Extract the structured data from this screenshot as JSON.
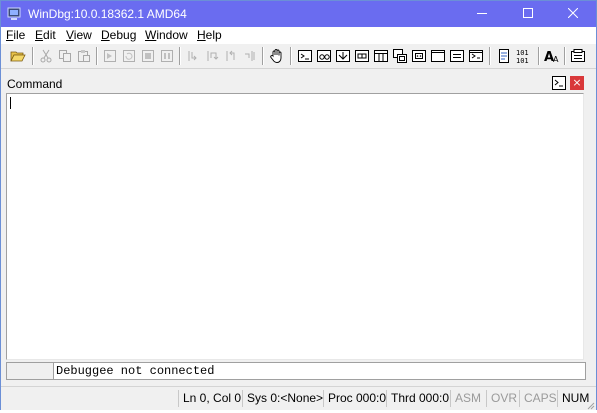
{
  "window": {
    "title": "WinDbg:10.0.18362.1 AMD64",
    "title_bar_color": "#6a6cf0",
    "controls": [
      "minimize-icon",
      "maximize-icon",
      "close-icon"
    ]
  },
  "menu": {
    "items": [
      {
        "label": "File"
      },
      {
        "label": "Edit"
      },
      {
        "label": "View"
      },
      {
        "label": "Debug"
      },
      {
        "label": "Window"
      },
      {
        "label": "Help"
      }
    ]
  },
  "toolbar": {
    "buttons": [
      {
        "icon": "open-folder-icon",
        "enabled": true
      },
      {
        "icon": "cut-icon",
        "enabled": false
      },
      {
        "icon": "copy-icon",
        "enabled": false
      },
      {
        "icon": "paste-icon",
        "enabled": false
      },
      {
        "icon": "go-icon",
        "enabled": false
      },
      {
        "icon": "restart-icon",
        "enabled": false
      },
      {
        "icon": "stop-debugging-icon",
        "enabled": false
      },
      {
        "icon": "break-icon",
        "enabled": false
      },
      {
        "icon": "step-into-icon",
        "enabled": false
      },
      {
        "icon": "step-over-icon",
        "enabled": false
      },
      {
        "icon": "step-out-icon",
        "enabled": false
      },
      {
        "icon": "run-to-cursor-icon",
        "enabled": false
      },
      {
        "icon": "source-mode-hand-icon",
        "enabled": true
      },
      {
        "icon": "command-window-icon",
        "enabled": true
      },
      {
        "icon": "watch-window-icon",
        "enabled": true
      },
      {
        "icon": "locals-window-icon",
        "enabled": true
      },
      {
        "icon": "registers-window-icon",
        "enabled": true
      },
      {
        "icon": "memory-window-icon",
        "enabled": true
      },
      {
        "icon": "call-stack-window-icon",
        "enabled": true
      },
      {
        "icon": "disassembly-window-icon",
        "enabled": true
      },
      {
        "icon": "scratch-pad-window-icon",
        "enabled": true
      },
      {
        "icon": "processes-threads-window-icon",
        "enabled": true
      },
      {
        "icon": "command-browser-window-icon",
        "enabled": true
      },
      {
        "icon": "source-mode-icon",
        "enabled": true
      },
      {
        "icon": "hex-mode-icon",
        "enabled": true
      },
      {
        "icon": "font-icon",
        "enabled": true
      },
      {
        "icon": "options-icon",
        "enabled": true
      }
    ]
  },
  "command_window": {
    "title": "Command",
    "output_text": "",
    "input_text": "Debuggee not connected"
  },
  "statusbar": {
    "ln_col": "Ln 0, Col 0",
    "sys": "Sys 0:<None>",
    "proc": "Proc 000:0",
    "thrd": "Thrd 000:0",
    "asm": "ASM",
    "ovr": "OVR",
    "caps": "CAPS",
    "num": "NUM"
  }
}
